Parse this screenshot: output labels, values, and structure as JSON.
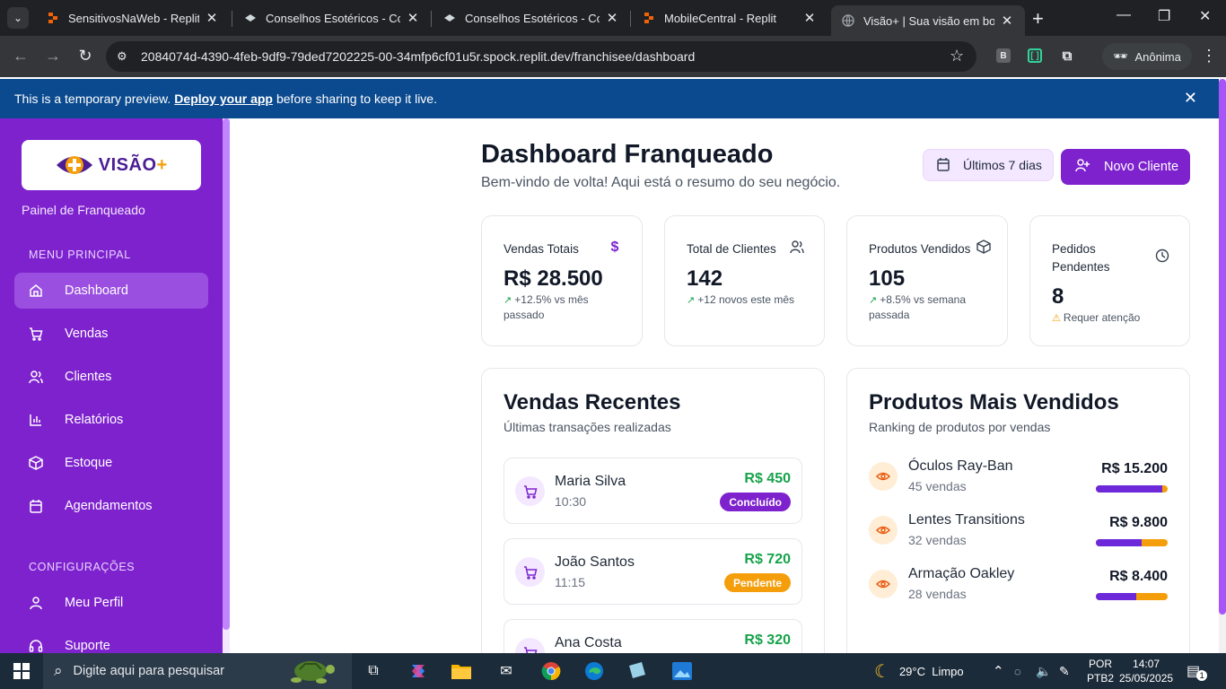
{
  "browser": {
    "tabs": [
      {
        "title": "SensitivosNaWeb - Replit",
        "active": false
      },
      {
        "title": "Conselhos Esotéricos - Cons",
        "active": false
      },
      {
        "title": "Conselhos Esotéricos - Cons",
        "active": false
      },
      {
        "title": "MobileCentral - Replit",
        "active": false
      },
      {
        "title": "Visão+ | Sua visão em boas",
        "active": true
      }
    ],
    "url": "2084074d-4390-4feb-9df9-79ded7202225-00-34mfp6cf01u5r.spock.replit.dev/franchisee/dashboard",
    "profile_label": "Anônima",
    "ext_b": "B"
  },
  "banner": {
    "prefix": "This is a temporary preview.",
    "link": "Deploy your app",
    "suffix": "before sharing to keep it live."
  },
  "sidebar": {
    "logo_text": "VISÃO",
    "logo_plus": "+",
    "panel_label": "Painel de Franqueado",
    "menu_title": "MENU PRINCIPAL",
    "items": [
      {
        "label": "Dashboard",
        "icon": "home-icon"
      },
      {
        "label": "Vendas",
        "icon": "cart-icon"
      },
      {
        "label": "Clientes",
        "icon": "users-icon"
      },
      {
        "label": "Relatórios",
        "icon": "chart-icon"
      },
      {
        "label": "Estoque",
        "icon": "package-icon"
      },
      {
        "label": "Agendamentos",
        "icon": "calendar-icon"
      }
    ],
    "config_title": "CONFIGURAÇÕES",
    "config_items": [
      {
        "label": "Meu Perfil",
        "icon": "user-icon"
      },
      {
        "label": "Suporte",
        "icon": "headset-icon"
      }
    ]
  },
  "header": {
    "title": "Dashboard Franqueado",
    "subtitle": "Bem-vindo de volta! Aqui está o resumo do seu negócio.",
    "period_label": "Últimos 7 dias",
    "new_client_label": "Novo Cliente"
  },
  "stats": [
    {
      "label": "Vendas Totais",
      "value": "R$ 28.500",
      "note": "+12.5% vs mês passado",
      "icon": "dollar-icon"
    },
    {
      "label": "Total de Clientes",
      "value": "142",
      "note": "+12 novos este mês",
      "icon": "users-icon"
    },
    {
      "label": "Produtos Vendidos",
      "value": "105",
      "note": "+8.5% vs semana passada",
      "icon": "package-icon"
    },
    {
      "label": "Pedidos Pendentes",
      "value": "8",
      "note": "Requer atenção",
      "icon": "clock-icon"
    }
  ],
  "recent_sales": {
    "title": "Vendas Recentes",
    "subtitle": "Últimas transações realizadas",
    "items": [
      {
        "name": "Maria Silva",
        "time": "10:30",
        "amount": "R$ 450",
        "status": "Concluído",
        "status_color": "#7e22ce"
      },
      {
        "name": "João Santos",
        "time": "11:15",
        "amount": "R$ 720",
        "status": "Pendente",
        "status_color": "#f59e0b"
      },
      {
        "name": "Ana Costa",
        "time": "",
        "amount": "R$ 320",
        "status": "",
        "status_color": "#7e22ce"
      }
    ]
  },
  "top_products": {
    "title": "Produtos Mais Vendidos",
    "subtitle": "Ranking de produtos por vendas",
    "items": [
      {
        "name": "Óculos Ray-Ban",
        "count": "45 vendas",
        "value": "R$ 15.200",
        "share": 0.92
      },
      {
        "name": "Lentes Transitions",
        "count": "32 vendas",
        "value": "R$ 9.800",
        "share": 0.64
      },
      {
        "name": "Armação Oakley",
        "count": "28 vendas",
        "value": "R$ 8.400",
        "share": 0.56
      }
    ]
  },
  "taskbar": {
    "search_placeholder": "Digite aqui para pesquisar",
    "weather": "29°C  Limpo",
    "lang_top": "POR",
    "lang_bottom": "PTB2",
    "time": "14:07",
    "date": "25/05/2025",
    "notif_count": "1"
  },
  "colors": {
    "brand": "#7e22ce",
    "success": "#16a34a",
    "warning": "#f59e0b"
  }
}
